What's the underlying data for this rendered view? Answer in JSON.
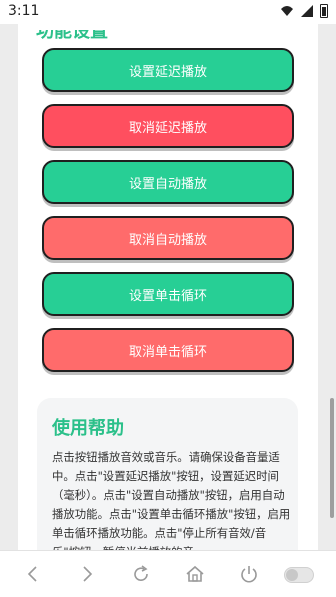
{
  "status_bar": {
    "time": "3:11"
  },
  "section_header": {
    "title": "功能设置"
  },
  "buttons": [
    {
      "label": "设置延迟播放",
      "style": "green"
    },
    {
      "label": "取消延迟播放",
      "style": "red"
    },
    {
      "label": "设置自动播放",
      "style": "green"
    },
    {
      "label": "取消自动播放",
      "style": "salmon"
    },
    {
      "label": "设置单击循环",
      "style": "green"
    },
    {
      "label": "取消单击循环",
      "style": "salmon"
    }
  ],
  "help": {
    "title": "使用帮助",
    "text": "点击按钮播放音效或音乐。请确保设备音量适中。点击\"设置延迟播放\"按钮，设置延迟时间（毫秒）。点击\"设置自动播放\"按钮，启用自动播放功能。点击\"设置单击循环播放\"按钮，启用单击循环播放功能。点击\"停止所有音效/音乐\"按钮，暂停当前播放的音"
  },
  "colors": {
    "accent_green": "#27cf95",
    "title_green": "#2bc08a",
    "danger_red": "#ff4f5f",
    "salmon": "#ff6b6b"
  },
  "toolbar_icons": [
    "back-icon",
    "forward-icon",
    "refresh-icon",
    "home-icon",
    "power-icon",
    "toggle-switch"
  ]
}
